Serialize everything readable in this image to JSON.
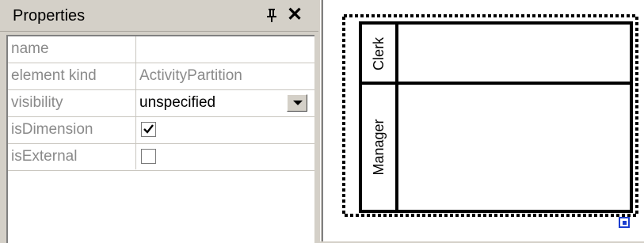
{
  "properties_panel": {
    "title": "Properties",
    "pin_icon": "pin-icon",
    "close_icon": "close-icon",
    "rows": [
      {
        "name": "name",
        "value": ""
      },
      {
        "name": "element kind",
        "value": "ActivityPartition"
      },
      {
        "name": "visibility",
        "value": "unspecified",
        "control": "dropdown"
      },
      {
        "name": "isDimension",
        "checked": true,
        "control": "checkbox"
      },
      {
        "name": "isExternal",
        "checked": false,
        "control": "checkbox"
      }
    ]
  },
  "diagram": {
    "partitions": [
      {
        "label": "Clerk"
      },
      {
        "label": "Manager"
      }
    ],
    "resize_handle_icon": "resize-handle-icon"
  },
  "colors": {
    "panel_bg": "#d4d0c8",
    "grid_bg": "#ffffff",
    "resize_handle": "#1a3ecf"
  }
}
